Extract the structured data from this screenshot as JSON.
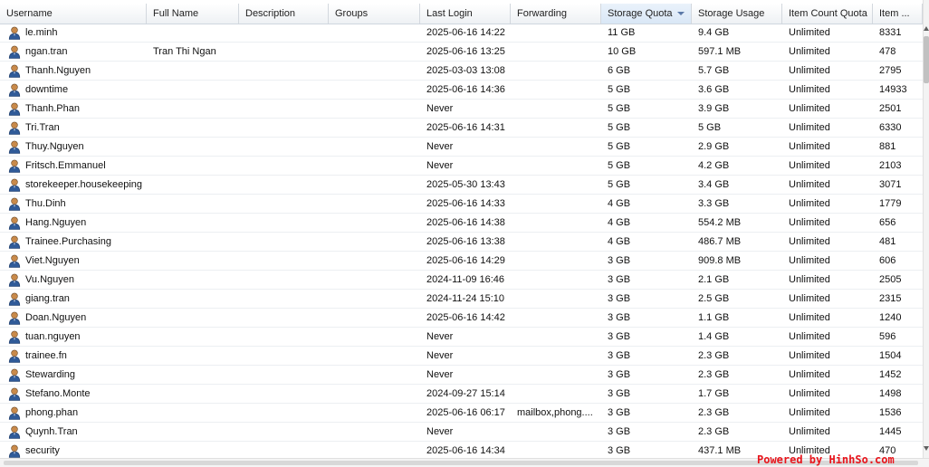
{
  "columns": [
    {
      "key": "username",
      "label": "Username"
    },
    {
      "key": "fullname",
      "label": "Full Name"
    },
    {
      "key": "description",
      "label": "Description"
    },
    {
      "key": "groups",
      "label": "Groups"
    },
    {
      "key": "last_login",
      "label": "Last Login"
    },
    {
      "key": "forwarding",
      "label": "Forwarding"
    },
    {
      "key": "storage_quota",
      "label": "Storage Quota",
      "sorted": "descending"
    },
    {
      "key": "storage_usage",
      "label": "Storage Usage"
    },
    {
      "key": "item_count_quota",
      "label": "Item Count Quota"
    },
    {
      "key": "item_count",
      "label": "Item ..."
    }
  ],
  "rows": [
    {
      "username": "le.minh",
      "fullname": "",
      "description": "",
      "groups": "",
      "last_login": "2025-06-16 14:22",
      "forwarding": "",
      "storage_quota": "11 GB",
      "storage_usage": "9.4 GB",
      "item_count_quota": "Unlimited",
      "item_count": "8331"
    },
    {
      "username": "ngan.tran",
      "fullname": "Tran Thi Ngan",
      "description": "",
      "groups": "",
      "last_login": "2025-06-16 13:25",
      "forwarding": "",
      "storage_quota": "10 GB",
      "storage_usage": "597.1 MB",
      "item_count_quota": "Unlimited",
      "item_count": "478"
    },
    {
      "username": "Thanh.Nguyen",
      "fullname": "",
      "description": "",
      "groups": "",
      "last_login": "2025-03-03 13:08",
      "forwarding": "",
      "storage_quota": "6 GB",
      "storage_usage": "5.7 GB",
      "item_count_quota": "Unlimited",
      "item_count": "2795"
    },
    {
      "username": "downtime",
      "fullname": "",
      "description": "",
      "groups": "",
      "last_login": "2025-06-16 14:36",
      "forwarding": "",
      "storage_quota": "5 GB",
      "storage_usage": "3.6 GB",
      "item_count_quota": "Unlimited",
      "item_count": "14933"
    },
    {
      "username": "Thanh.Phan",
      "fullname": "",
      "description": "",
      "groups": "",
      "last_login": "Never",
      "forwarding": "",
      "storage_quota": "5 GB",
      "storage_usage": "3.9 GB",
      "item_count_quota": "Unlimited",
      "item_count": "2501"
    },
    {
      "username": "Tri.Tran",
      "fullname": "",
      "description": "",
      "groups": "",
      "last_login": "2025-06-16 14:31",
      "forwarding": "",
      "storage_quota": "5 GB",
      "storage_usage": "5 GB",
      "item_count_quota": "Unlimited",
      "item_count": "6330"
    },
    {
      "username": "Thuy.Nguyen",
      "fullname": "",
      "description": "",
      "groups": "",
      "last_login": "Never",
      "forwarding": "",
      "storage_quota": "5 GB",
      "storage_usage": "2.9 GB",
      "item_count_quota": "Unlimited",
      "item_count": "881"
    },
    {
      "username": "Fritsch.Emmanuel",
      "fullname": "",
      "description": "",
      "groups": "",
      "last_login": "Never",
      "forwarding": "",
      "storage_quota": "5 GB",
      "storage_usage": "4.2 GB",
      "item_count_quota": "Unlimited",
      "item_count": "2103"
    },
    {
      "username": "storekeeper.housekeeping",
      "fullname": "",
      "description": "",
      "groups": "",
      "last_login": "2025-05-30 13:43",
      "forwarding": "",
      "storage_quota": "5 GB",
      "storage_usage": "3.4 GB",
      "item_count_quota": "Unlimited",
      "item_count": "3071"
    },
    {
      "username": "Thu.Dinh",
      "fullname": "",
      "description": "",
      "groups": "",
      "last_login": "2025-06-16 14:33",
      "forwarding": "",
      "storage_quota": "4 GB",
      "storage_usage": "3.3 GB",
      "item_count_quota": "Unlimited",
      "item_count": "1779"
    },
    {
      "username": "Hang.Nguyen",
      "fullname": "",
      "description": "",
      "groups": "",
      "last_login": "2025-06-16 14:38",
      "forwarding": "",
      "storage_quota": "4 GB",
      "storage_usage": "554.2 MB",
      "item_count_quota": "Unlimited",
      "item_count": "656"
    },
    {
      "username": "Trainee.Purchasing",
      "fullname": "",
      "description": "",
      "groups": "",
      "last_login": "2025-06-16 13:38",
      "forwarding": "",
      "storage_quota": "4 GB",
      "storage_usage": "486.7 MB",
      "item_count_quota": "Unlimited",
      "item_count": "481"
    },
    {
      "username": "Viet.Nguyen",
      "fullname": "",
      "description": "",
      "groups": "",
      "last_login": "2025-06-16 14:29",
      "forwarding": "",
      "storage_quota": "3 GB",
      "storage_usage": "909.8 MB",
      "item_count_quota": "Unlimited",
      "item_count": "606"
    },
    {
      "username": "Vu.Nguyen",
      "fullname": "",
      "description": "",
      "groups": "",
      "last_login": "2024-11-09 16:46",
      "forwarding": "",
      "storage_quota": "3 GB",
      "storage_usage": "2.1 GB",
      "item_count_quota": "Unlimited",
      "item_count": "2505"
    },
    {
      "username": "giang.tran",
      "fullname": "",
      "description": "",
      "groups": "",
      "last_login": "2024-11-24 15:10",
      "forwarding": "",
      "storage_quota": "3 GB",
      "storage_usage": "2.5 GB",
      "item_count_quota": "Unlimited",
      "item_count": "2315"
    },
    {
      "username": "Doan.Nguyen",
      "fullname": "",
      "description": "",
      "groups": "",
      "last_login": "2025-06-16 14:42",
      "forwarding": "",
      "storage_quota": "3 GB",
      "storage_usage": "1.1 GB",
      "item_count_quota": "Unlimited",
      "item_count": "1240"
    },
    {
      "username": "tuan.nguyen",
      "fullname": "",
      "description": "",
      "groups": "",
      "last_login": "Never",
      "forwarding": "",
      "storage_quota": "3 GB",
      "storage_usage": "1.4 GB",
      "item_count_quota": "Unlimited",
      "item_count": "596"
    },
    {
      "username": "trainee.fn",
      "fullname": "",
      "description": "",
      "groups": "",
      "last_login": "Never",
      "forwarding": "",
      "storage_quota": "3 GB",
      "storage_usage": "2.3 GB",
      "item_count_quota": "Unlimited",
      "item_count": "1504"
    },
    {
      "username": "Stewarding",
      "fullname": "",
      "description": "",
      "groups": "",
      "last_login": "Never",
      "forwarding": "",
      "storage_quota": "3 GB",
      "storage_usage": "2.3 GB",
      "item_count_quota": "Unlimited",
      "item_count": "1452"
    },
    {
      "username": "Stefano.Monte",
      "fullname": "",
      "description": "",
      "groups": "",
      "last_login": "2024-09-27 15:14",
      "forwarding": "",
      "storage_quota": "3 GB",
      "storage_usage": "1.7 GB",
      "item_count_quota": "Unlimited",
      "item_count": "1498"
    },
    {
      "username": "phong.phan",
      "fullname": "",
      "description": "",
      "groups": "",
      "last_login": "2025-06-16 06:17",
      "forwarding": "mailbox,phong....",
      "storage_quota": "3 GB",
      "storage_usage": "2.3 GB",
      "item_count_quota": "Unlimited",
      "item_count": "1536"
    },
    {
      "username": "Quynh.Tran",
      "fullname": "",
      "description": "",
      "groups": "",
      "last_login": "Never",
      "forwarding": "",
      "storage_quota": "3 GB",
      "storage_usage": "2.3 GB",
      "item_count_quota": "Unlimited",
      "item_count": "1445"
    },
    {
      "username": "security",
      "fullname": "",
      "description": "",
      "groups": "",
      "last_login": "2025-06-16 14:34",
      "forwarding": "",
      "storage_quota": "3 GB",
      "storage_usage": "437.1 MB",
      "item_count_quota": "Unlimited",
      "item_count": "470"
    }
  ],
  "watermark": "Powered by HinhSo.com",
  "colors": {
    "header_sorted": "#d9e7f6",
    "row_border": "#eceff2",
    "watermark": "#e8141b",
    "icon_head": "#c98a4a",
    "icon_body": "#2f5a98"
  }
}
